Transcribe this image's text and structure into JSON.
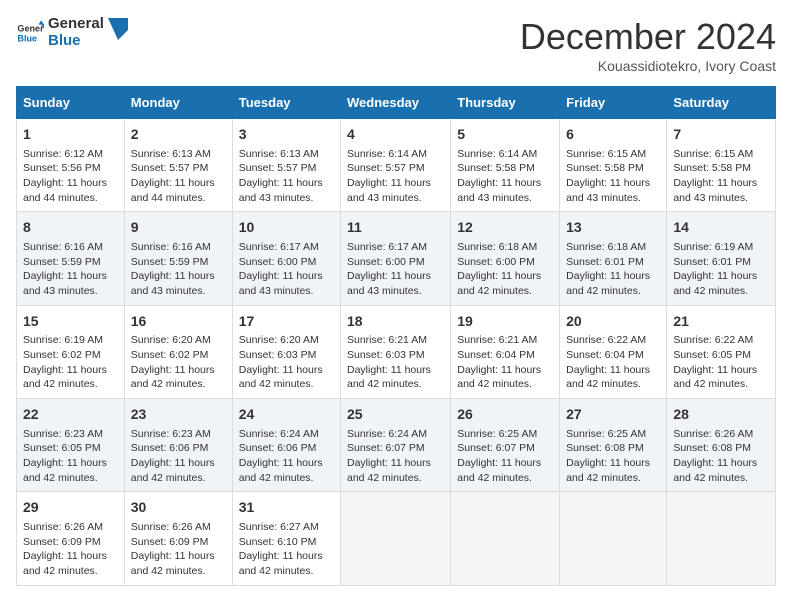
{
  "header": {
    "logo_line1": "General",
    "logo_line2": "Blue",
    "month_title": "December 2024",
    "subtitle": "Kouassidiotekro, Ivory Coast"
  },
  "days_of_week": [
    "Sunday",
    "Monday",
    "Tuesday",
    "Wednesday",
    "Thursday",
    "Friday",
    "Saturday"
  ],
  "weeks": [
    [
      {
        "day": "1",
        "sunrise": "6:12 AM",
        "sunset": "5:56 PM",
        "daylight": "11 hours and 44 minutes."
      },
      {
        "day": "2",
        "sunrise": "6:13 AM",
        "sunset": "5:57 PM",
        "daylight": "11 hours and 44 minutes."
      },
      {
        "day": "3",
        "sunrise": "6:13 AM",
        "sunset": "5:57 PM",
        "daylight": "11 hours and 43 minutes."
      },
      {
        "day": "4",
        "sunrise": "6:14 AM",
        "sunset": "5:57 PM",
        "daylight": "11 hours and 43 minutes."
      },
      {
        "day": "5",
        "sunrise": "6:14 AM",
        "sunset": "5:58 PM",
        "daylight": "11 hours and 43 minutes."
      },
      {
        "day": "6",
        "sunrise": "6:15 AM",
        "sunset": "5:58 PM",
        "daylight": "11 hours and 43 minutes."
      },
      {
        "day": "7",
        "sunrise": "6:15 AM",
        "sunset": "5:58 PM",
        "daylight": "11 hours and 43 minutes."
      }
    ],
    [
      {
        "day": "8",
        "sunrise": "6:16 AM",
        "sunset": "5:59 PM",
        "daylight": "11 hours and 43 minutes."
      },
      {
        "day": "9",
        "sunrise": "6:16 AM",
        "sunset": "5:59 PM",
        "daylight": "11 hours and 43 minutes."
      },
      {
        "day": "10",
        "sunrise": "6:17 AM",
        "sunset": "6:00 PM",
        "daylight": "11 hours and 43 minutes."
      },
      {
        "day": "11",
        "sunrise": "6:17 AM",
        "sunset": "6:00 PM",
        "daylight": "11 hours and 43 minutes."
      },
      {
        "day": "12",
        "sunrise": "6:18 AM",
        "sunset": "6:00 PM",
        "daylight": "11 hours and 42 minutes."
      },
      {
        "day": "13",
        "sunrise": "6:18 AM",
        "sunset": "6:01 PM",
        "daylight": "11 hours and 42 minutes."
      },
      {
        "day": "14",
        "sunrise": "6:19 AM",
        "sunset": "6:01 PM",
        "daylight": "11 hours and 42 minutes."
      }
    ],
    [
      {
        "day": "15",
        "sunrise": "6:19 AM",
        "sunset": "6:02 PM",
        "daylight": "11 hours and 42 minutes."
      },
      {
        "day": "16",
        "sunrise": "6:20 AM",
        "sunset": "6:02 PM",
        "daylight": "11 hours and 42 minutes."
      },
      {
        "day": "17",
        "sunrise": "6:20 AM",
        "sunset": "6:03 PM",
        "daylight": "11 hours and 42 minutes."
      },
      {
        "day": "18",
        "sunrise": "6:21 AM",
        "sunset": "6:03 PM",
        "daylight": "11 hours and 42 minutes."
      },
      {
        "day": "19",
        "sunrise": "6:21 AM",
        "sunset": "6:04 PM",
        "daylight": "11 hours and 42 minutes."
      },
      {
        "day": "20",
        "sunrise": "6:22 AM",
        "sunset": "6:04 PM",
        "daylight": "11 hours and 42 minutes."
      },
      {
        "day": "21",
        "sunrise": "6:22 AM",
        "sunset": "6:05 PM",
        "daylight": "11 hours and 42 minutes."
      }
    ],
    [
      {
        "day": "22",
        "sunrise": "6:23 AM",
        "sunset": "6:05 PM",
        "daylight": "11 hours and 42 minutes."
      },
      {
        "day": "23",
        "sunrise": "6:23 AM",
        "sunset": "6:06 PM",
        "daylight": "11 hours and 42 minutes."
      },
      {
        "day": "24",
        "sunrise": "6:24 AM",
        "sunset": "6:06 PM",
        "daylight": "11 hours and 42 minutes."
      },
      {
        "day": "25",
        "sunrise": "6:24 AM",
        "sunset": "6:07 PM",
        "daylight": "11 hours and 42 minutes."
      },
      {
        "day": "26",
        "sunrise": "6:25 AM",
        "sunset": "6:07 PM",
        "daylight": "11 hours and 42 minutes."
      },
      {
        "day": "27",
        "sunrise": "6:25 AM",
        "sunset": "6:08 PM",
        "daylight": "11 hours and 42 minutes."
      },
      {
        "day": "28",
        "sunrise": "6:26 AM",
        "sunset": "6:08 PM",
        "daylight": "11 hours and 42 minutes."
      }
    ],
    [
      {
        "day": "29",
        "sunrise": "6:26 AM",
        "sunset": "6:09 PM",
        "daylight": "11 hours and 42 minutes."
      },
      {
        "day": "30",
        "sunrise": "6:26 AM",
        "sunset": "6:09 PM",
        "daylight": "11 hours and 42 minutes."
      },
      {
        "day": "31",
        "sunrise": "6:27 AM",
        "sunset": "6:10 PM",
        "daylight": "11 hours and 42 minutes."
      },
      null,
      null,
      null,
      null
    ]
  ],
  "labels": {
    "sunrise": "Sunrise:",
    "sunset": "Sunset:",
    "daylight": "Daylight:"
  }
}
